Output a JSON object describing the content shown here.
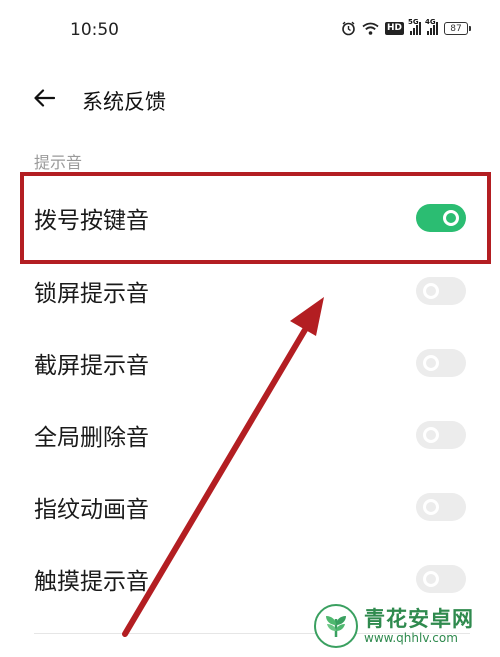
{
  "status_bar": {
    "time": "10:50",
    "hd_label": "HD",
    "signal1_tag": "5G",
    "signal2_tag": "4G",
    "battery_level": "87",
    "icons": [
      "alarm-icon",
      "wifi-icon",
      "hd-icon",
      "signal-5g-icon",
      "signal-4g-icon",
      "battery-icon"
    ]
  },
  "header": {
    "title": "系统反馈",
    "back_icon": "arrow-left-icon"
  },
  "section": {
    "label": "提示音"
  },
  "settings": [
    {
      "label": "拨号按键音",
      "enabled": true
    },
    {
      "label": "锁屏提示音",
      "enabled": false
    },
    {
      "label": "截屏提示音",
      "enabled": false
    },
    {
      "label": "全局删除音",
      "enabled": false
    },
    {
      "label": "指纹动画音",
      "enabled": false
    },
    {
      "label": "触摸提示音",
      "enabled": false
    }
  ],
  "annotation": {
    "box_color": "#b31e22",
    "arrow_color": "#b31e22"
  },
  "colors": {
    "toggle_on": "#2bbd72",
    "toggle_off": "#ececec"
  },
  "watermark": {
    "title": "青花安卓网",
    "url": "www.qhhlv.com"
  }
}
